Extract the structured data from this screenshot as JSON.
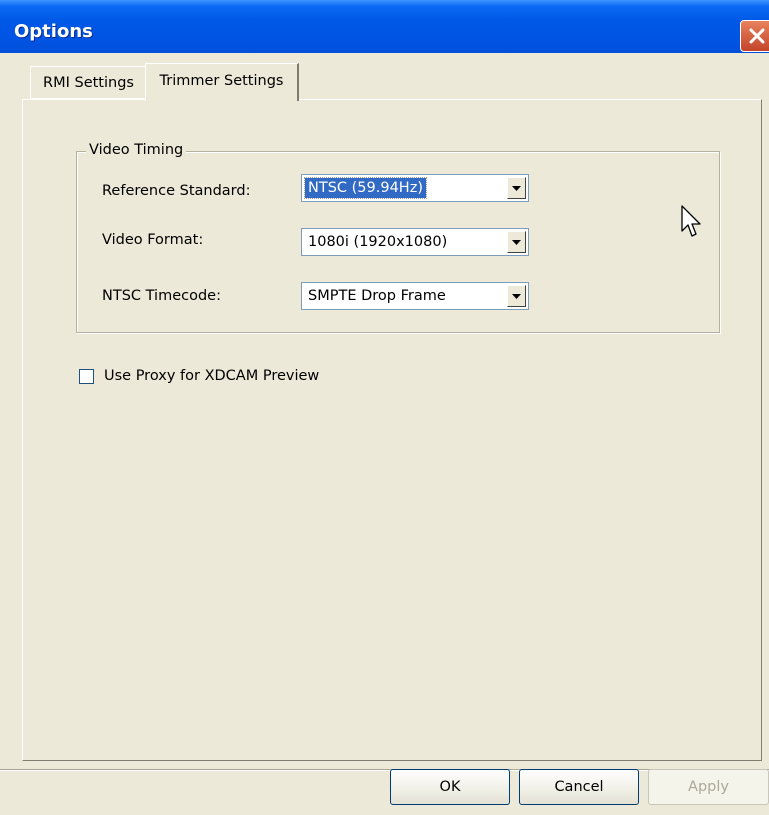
{
  "window": {
    "title": "Options"
  },
  "tabs": [
    {
      "label": "RMI Settings",
      "active": false
    },
    {
      "label": "Trimmer Settings",
      "active": true
    }
  ],
  "video_timing": {
    "legend": "Video Timing",
    "reference_standard": {
      "label": "Reference Standard:",
      "value": "NTSC (59.94Hz)"
    },
    "video_format": {
      "label": "Video Format:",
      "value": "1080i (1920x1080)"
    },
    "ntsc_timecode": {
      "label": "NTSC Timecode:",
      "value": "SMPTE Drop Frame"
    }
  },
  "proxy_option": {
    "label": "Use Proxy for XDCAM Preview",
    "checked": false
  },
  "buttons": {
    "ok": "OK",
    "cancel": "Cancel",
    "apply": "Apply"
  },
  "icons": {
    "close": "close-icon",
    "dropdown": "chevron-down-icon",
    "cursor": "mouse-pointer-icon"
  },
  "colors": {
    "titlebar": "#0054e3",
    "dialog_bg": "#ece9d8",
    "selection": "#316ac5",
    "close_button": "#c4442a"
  }
}
